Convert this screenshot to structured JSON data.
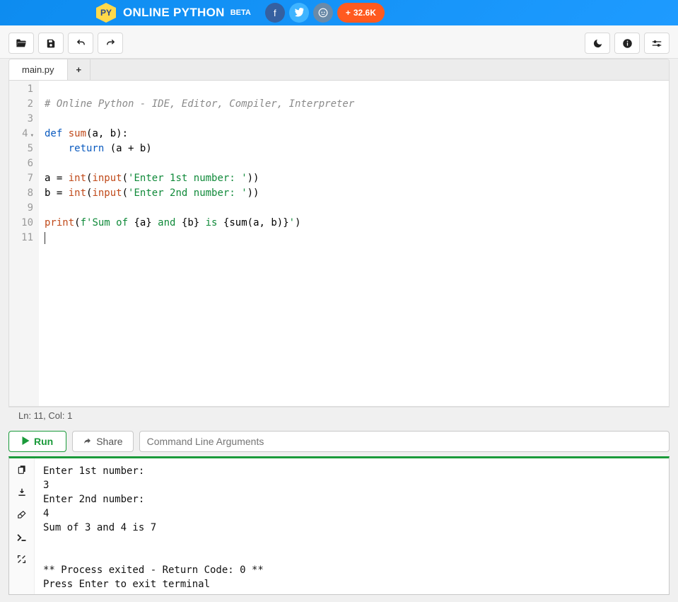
{
  "header": {
    "brand": "ONLINE PYTHON",
    "beta": "BETA",
    "logo_text": "PY",
    "upvote_count": "32.6K"
  },
  "toolbar": {
    "open_icon": "folder-open-icon",
    "save_icon": "save-icon",
    "undo_icon": "undo-icon",
    "redo_icon": "redo-icon",
    "dark_icon": "moon-icon",
    "info_icon": "info-icon",
    "settings_icon": "settings-icon"
  },
  "tabs": {
    "items": [
      {
        "label": "main.py"
      }
    ],
    "add_label": "+"
  },
  "editor": {
    "lines": [
      {
        "n": 1,
        "segs": []
      },
      {
        "n": 2,
        "segs": [
          {
            "t": "# Online Python - IDE, Editor, Compiler, Interpreter",
            "c": "tok-comment"
          }
        ]
      },
      {
        "n": 3,
        "segs": []
      },
      {
        "n": 4,
        "fold": true,
        "segs": [
          {
            "t": "def ",
            "c": "tok-kw"
          },
          {
            "t": "sum",
            "c": "tok-fn"
          },
          {
            "t": "(a, b):",
            "c": ""
          }
        ]
      },
      {
        "n": 5,
        "segs": [
          {
            "t": "    ",
            "c": ""
          },
          {
            "t": "return",
            "c": "tok-kw"
          },
          {
            "t": " (a + b)",
            "c": ""
          }
        ]
      },
      {
        "n": 6,
        "segs": []
      },
      {
        "n": 7,
        "segs": [
          {
            "t": "a = ",
            "c": ""
          },
          {
            "t": "int",
            "c": "tok-fn"
          },
          {
            "t": "(",
            "c": ""
          },
          {
            "t": "input",
            "c": "tok-fn"
          },
          {
            "t": "(",
            "c": ""
          },
          {
            "t": "'Enter 1st number: '",
            "c": "tok-str"
          },
          {
            "t": "))",
            "c": ""
          }
        ]
      },
      {
        "n": 8,
        "segs": [
          {
            "t": "b = ",
            "c": ""
          },
          {
            "t": "int",
            "c": "tok-fn"
          },
          {
            "t": "(",
            "c": ""
          },
          {
            "t": "input",
            "c": "tok-fn"
          },
          {
            "t": "(",
            "c": ""
          },
          {
            "t": "'Enter 2nd number: '",
            "c": "tok-str"
          },
          {
            "t": "))",
            "c": ""
          }
        ]
      },
      {
        "n": 9,
        "segs": []
      },
      {
        "n": 10,
        "segs": [
          {
            "t": "print",
            "c": "tok-fn"
          },
          {
            "t": "(",
            "c": ""
          },
          {
            "t": "f'Sum of ",
            "c": "tok-str"
          },
          {
            "t": "{a}",
            "c": ""
          },
          {
            "t": " and ",
            "c": "tok-str"
          },
          {
            "t": "{b}",
            "c": ""
          },
          {
            "t": " is ",
            "c": "tok-str"
          },
          {
            "t": "{sum(a, b)}",
            "c": ""
          },
          {
            "t": "'",
            "c": "tok-str"
          },
          {
            "t": ")",
            "c": ""
          }
        ]
      },
      {
        "n": 11,
        "segs": []
      }
    ]
  },
  "status": {
    "text": "Ln: 11,  Col: 1"
  },
  "controls": {
    "run_label": "Run",
    "share_label": "Share",
    "args_placeholder": "Command Line Arguments"
  },
  "terminal": {
    "lines": [
      "Enter 1st number: ",
      "3",
      "Enter 2nd number: ",
      "4",
      "Sum of 3 and 4 is 7",
      "",
      "",
      "** Process exited - Return Code: 0 **",
      "Press Enter to exit terminal"
    ]
  }
}
